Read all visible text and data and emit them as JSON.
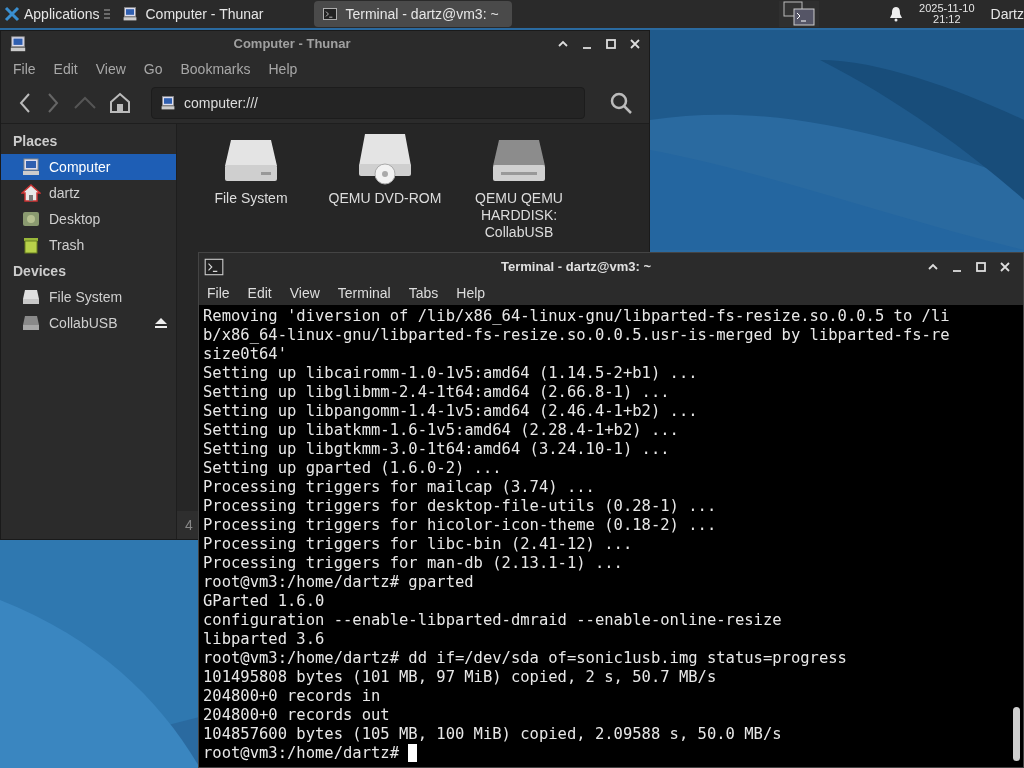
{
  "taskbar": {
    "app_menu": "Applications",
    "tasks": [
      {
        "title": "Computer - Thunar",
        "kind": "computer",
        "selected": false
      },
      {
        "title": "Terminal - dartz@vm3: ~",
        "kind": "terminal",
        "selected": true
      }
    ],
    "clock": {
      "date": "2025-11-10",
      "time": "21:12"
    },
    "user": "Dartz"
  },
  "file_manager": {
    "title": "Computer - Thunar",
    "menu": [
      "File",
      "Edit",
      "View",
      "Go",
      "Bookmarks",
      "Help"
    ],
    "location": "computer:///",
    "sidebar": [
      {
        "heading": "Places",
        "items": [
          {
            "label": "Computer",
            "kind": "computer",
            "selected": true,
            "ejectable": false
          },
          {
            "label": "dartz",
            "kind": "home",
            "selected": false,
            "ejectable": false
          },
          {
            "label": "Desktop",
            "kind": "desktop",
            "selected": false,
            "ejectable": false
          },
          {
            "label": "Trash",
            "kind": "trash",
            "selected": false,
            "ejectable": false
          }
        ]
      },
      {
        "heading": "Devices",
        "items": [
          {
            "label": "File System",
            "kind": "disk",
            "selected": false,
            "ejectable": false
          },
          {
            "label": "CollabUSB",
            "kind": "usb",
            "selected": false,
            "ejectable": true
          }
        ]
      }
    ],
    "items": [
      {
        "label": "File System",
        "kind": "disk"
      },
      {
        "label": "QEMU DVD-ROM",
        "kind": "optical"
      },
      {
        "label": "QEMU QEMU HARDDISK: CollabUSB",
        "kind": "usb"
      }
    ],
    "status_bar": "4"
  },
  "terminal": {
    "title": "Terminal - dartz@vm3: ~",
    "menu": [
      "File",
      "Edit",
      "View",
      "Terminal",
      "Tabs",
      "Help"
    ],
    "lines": [
      "Removing 'diversion of /lib/x86_64-linux-gnu/libparted-fs-resize.so.0.0.5 to /li",
      "b/x86_64-linux-gnu/libparted-fs-resize.so.0.0.5.usr-is-merged by libparted-fs-re",
      "size0t64'",
      "Setting up libcairomm-1.0-1v5:amd64 (1.14.5-2+b1) ...",
      "Setting up libglibmm-2.4-1t64:amd64 (2.66.8-1) ...",
      "Setting up libpangomm-1.4-1v5:amd64 (2.46.4-1+b2) ...",
      "Setting up libatkmm-1.6-1v5:amd64 (2.28.4-1+b2) ...",
      "Setting up libgtkmm-3.0-1t64:amd64 (3.24.10-1) ...",
      "Setting up gparted (1.6.0-2) ...",
      "Processing triggers for mailcap (3.74) ...",
      "Processing triggers for desktop-file-utils (0.28-1) ...",
      "Processing triggers for hicolor-icon-theme (0.18-2) ...",
      "Processing triggers for libc-bin (2.41-12) ...",
      "Processing triggers for man-db (2.13.1-1) ...",
      "root@vm3:/home/dartz# gparted",
      "GParted 1.6.0",
      "configuration --enable-libparted-dmraid --enable-online-resize",
      "libparted 3.6",
      "root@vm3:/home/dartz# dd if=/dev/sda of=sonic1usb.img status=progress",
      "101495808 bytes (101 MB, 97 MiB) copied, 2 s, 50.7 MB/s",
      "204800+0 records in",
      "204800+0 records out",
      "104857600 bytes (105 MB, 100 MiB) copied, 2.09588 s, 50.0 MB/s",
      "root@vm3:/home/dartz# "
    ],
    "cursor": true
  }
}
